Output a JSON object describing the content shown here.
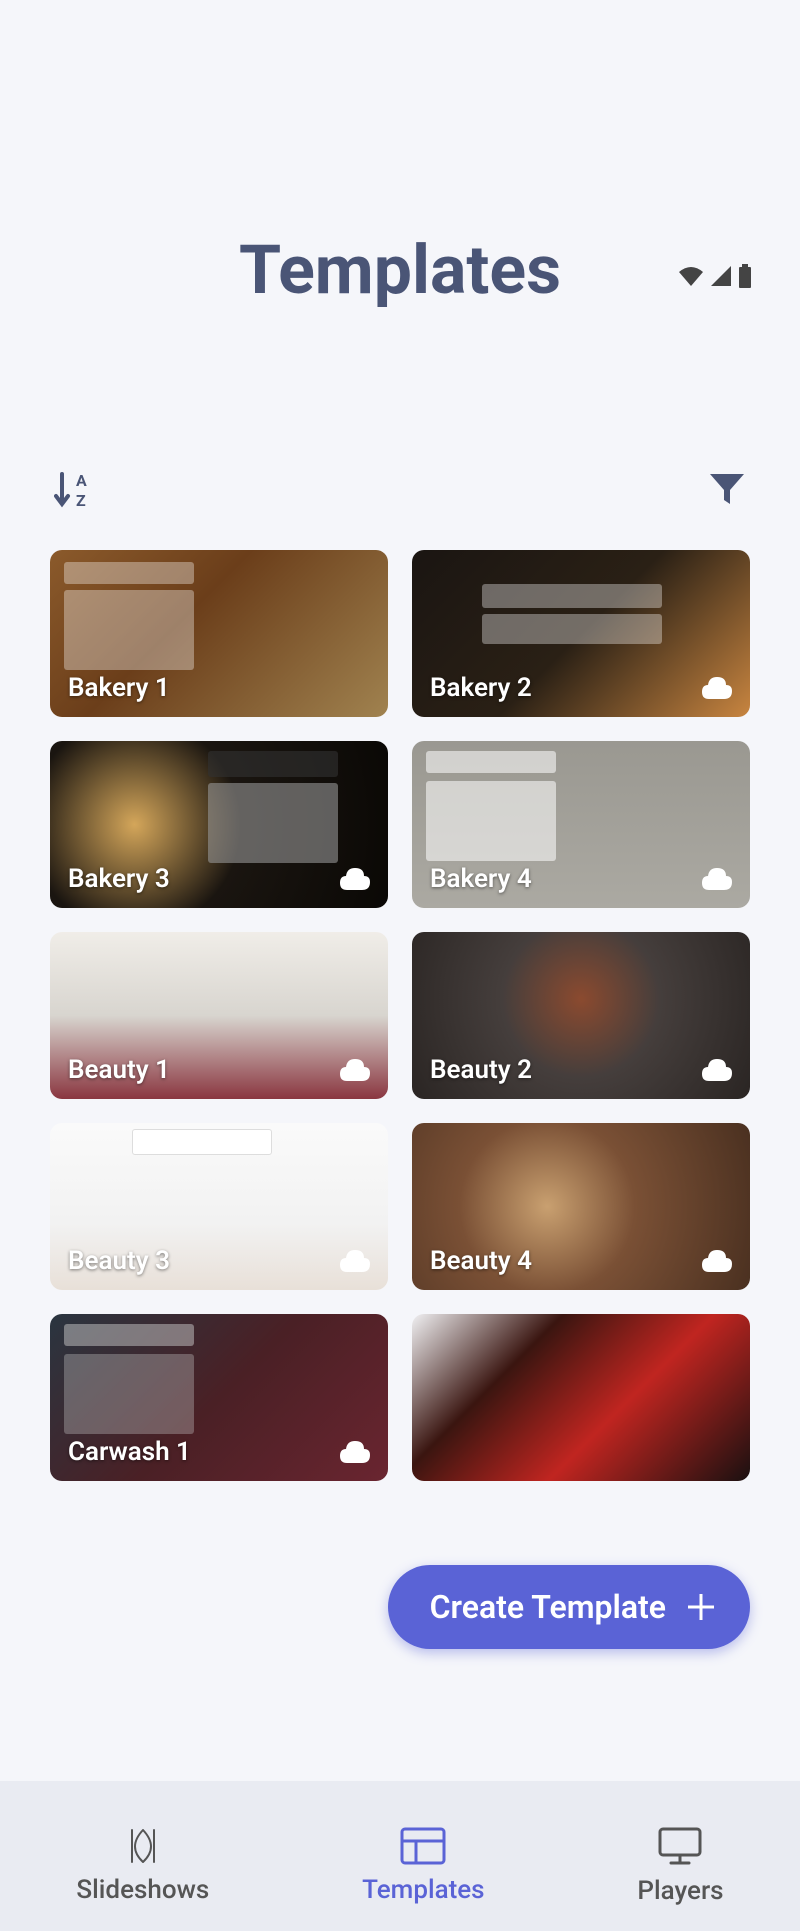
{
  "page": {
    "title": "Templates"
  },
  "fab": {
    "label": "Create Template"
  },
  "nav": {
    "slideshows": "Slideshows",
    "templates": "Templates",
    "players": "Players"
  },
  "templates": [
    {
      "label": "Bakery 1",
      "has_cloud": false
    },
    {
      "label": "Bakery 2",
      "has_cloud": true
    },
    {
      "label": "Bakery 3",
      "has_cloud": true
    },
    {
      "label": "Bakery 4",
      "has_cloud": true
    },
    {
      "label": "Beauty 1",
      "has_cloud": true
    },
    {
      "label": "Beauty 2",
      "has_cloud": true
    },
    {
      "label": "Beauty 3",
      "has_cloud": true
    },
    {
      "label": "Beauty 4",
      "has_cloud": true
    },
    {
      "label": "Carwash 1",
      "has_cloud": true
    },
    {
      "label": "",
      "has_cloud": false
    }
  ]
}
